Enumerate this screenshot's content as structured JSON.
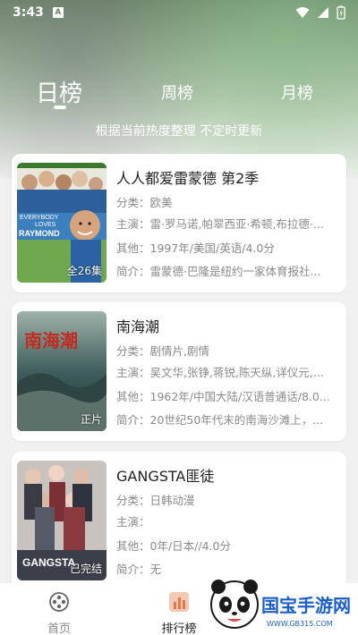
{
  "status": {
    "time": "3:43",
    "notif": "A"
  },
  "tabs": {
    "day": "日榜",
    "week": "周榜",
    "month": "月榜"
  },
  "subtitle": "根据当前热度整理 不定时更新",
  "items": [
    {
      "title": "人人都爱雷蒙德  第2季",
      "category": "分类：欧美",
      "cast": "主演：雷·罗马诺,帕翠西亚·希顿,布拉德·...",
      "other": "其他：1997年/美国/英语/4.0分",
      "intro": "简介：雷蒙德·巴隆是纽约一家体育报社...",
      "badge": "全26集",
      "poster_text_1": "EVERYBODY",
      "poster_text_2": "LOVES",
      "poster_text_3": "RAYMOND"
    },
    {
      "title": "南海潮",
      "category": "分类：剧情片,剧情",
      "cast": "主演：吴文华,张铮,蒋锐,陈天纵,详仪元,...",
      "other": "其他：1962年/中国大陆/汉语普通话/8.0...",
      "intro": "简介：20世纪50年代末的南海沙滩上，...",
      "badge": "正片",
      "poster_text_1": "南海潮"
    },
    {
      "title": "GANGSTA匪徒",
      "category": "分类：日韩动漫",
      "cast": "主演：",
      "other": "其他：0年/日本//4.0分",
      "intro": "简介：无",
      "badge": "已完结",
      "poster_text_1": "GANGSTA"
    }
  ],
  "nav": {
    "home": "首页",
    "rank": "排行榜"
  },
  "watermark": {
    "brand": "国宝手游网",
    "url": "WWW.GB315.COM"
  },
  "colors": {
    "accent": "#222222",
    "muted": "#8a8a8a"
  }
}
